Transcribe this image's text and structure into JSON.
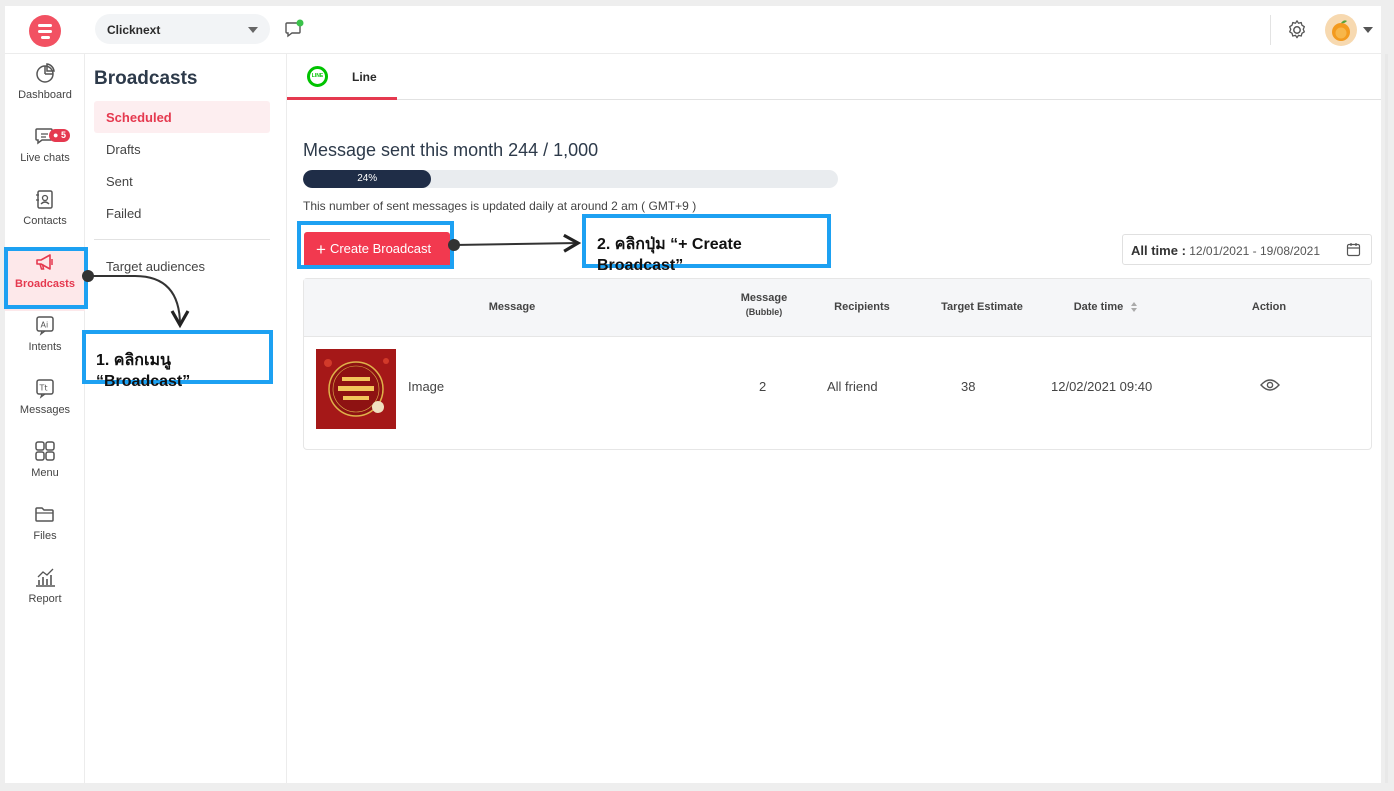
{
  "topbar": {
    "workspace": "Clicknext"
  },
  "leftnav": {
    "items": [
      {
        "label": "Dashboard",
        "icon": "pie-chart-icon"
      },
      {
        "label": "Live chats",
        "icon": "chat-icon",
        "badge": "5"
      },
      {
        "label": "Contacts",
        "icon": "contact-card-icon"
      },
      {
        "label": "Broadcasts",
        "icon": "megaphone-icon"
      },
      {
        "label": "Intents",
        "icon": "ai-icon"
      },
      {
        "label": "Messages",
        "icon": "text-message-icon"
      },
      {
        "label": "Menu",
        "icon": "grid-icon"
      },
      {
        "label": "Files",
        "icon": "folder-icon"
      },
      {
        "label": "Report",
        "icon": "bar-chart-icon"
      }
    ]
  },
  "subnav": {
    "title": "Broadcasts",
    "items": [
      "Scheduled",
      "Drafts",
      "Sent",
      "Failed"
    ],
    "extra": "Target audiences"
  },
  "main": {
    "tab": "Line",
    "quota_title": "Message sent this month 244 / 1,000",
    "progress": {
      "value": 0.24,
      "label": "24%"
    },
    "quota_note": "This number of sent messages is updated daily at around 2 am ( GMT+9 )",
    "create_button": "Create Broadcast",
    "date_filter": {
      "label": "All time :",
      "range": "12/01/2021 - 19/08/2021"
    },
    "table": {
      "headers": {
        "message": "Message",
        "message_bubble": "Message",
        "bubble_sub": "(Bubble)",
        "recipients": "Recipients",
        "target": "Target Estimate",
        "datetime": "Date time",
        "action": "Action"
      },
      "rows": [
        {
          "message": "Image",
          "bubble": "2",
          "recipients": "All friend",
          "target": "38",
          "datetime": "12/02/2021 09:40"
        }
      ]
    }
  },
  "annotations": {
    "step1": "1. คลิกเมนู “Broadcast”",
    "step2": "2. คลิกปุ่ม “+ Create Broadcast”"
  },
  "colors": {
    "accent": "#e5394f",
    "callout": "#1da1f2",
    "progress": "#1f2d47"
  }
}
